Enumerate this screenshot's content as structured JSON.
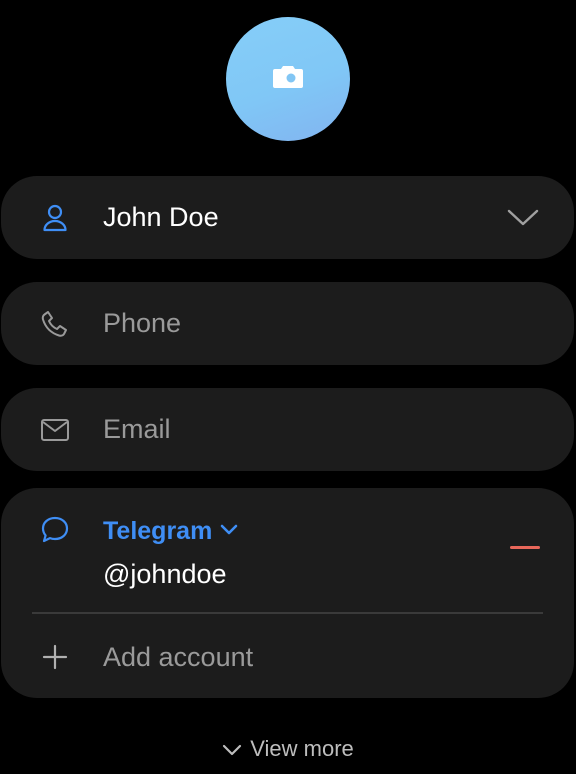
{
  "avatar": {
    "icon": "camera-icon"
  },
  "name_field": {
    "value": "John Doe",
    "icon": "person-icon"
  },
  "phone_field": {
    "placeholder": "Phone",
    "icon": "phone-icon"
  },
  "email_field": {
    "placeholder": "Email",
    "icon": "mail-icon"
  },
  "messenger": {
    "label": "Telegram",
    "value": "@johndoe",
    "icon": "chat-bubble-icon",
    "add_label": "Add account"
  },
  "view_more_label": "View more",
  "colors": {
    "accent": "#3f8ef5",
    "card": "#1c1c1c",
    "remove": "#e8675a",
    "placeholder": "#9a9a9a"
  }
}
